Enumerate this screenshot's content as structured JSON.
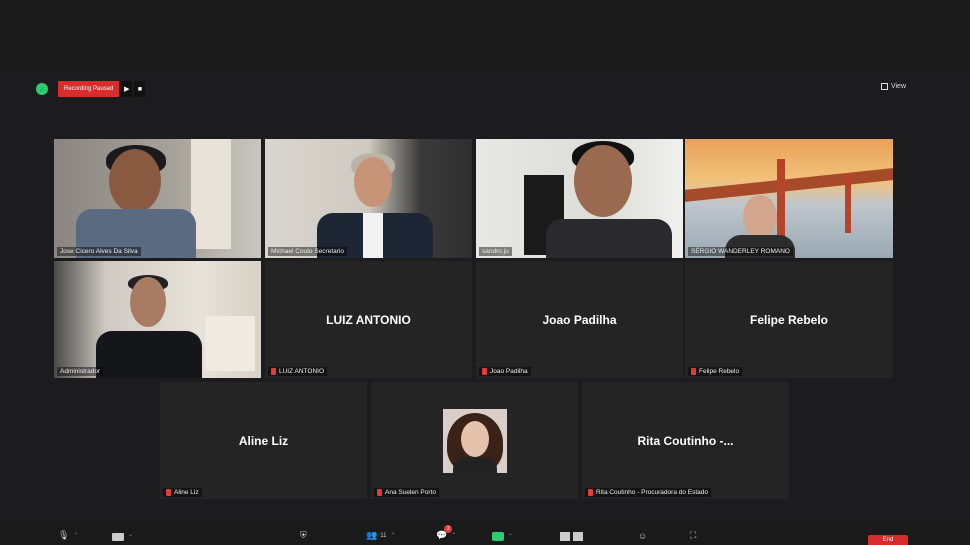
{
  "recording": {
    "status_label": "Recording Paused",
    "play_icon": "▶",
    "stop_icon": "■"
  },
  "view_button": {
    "label": "View"
  },
  "participants": [
    {
      "name": "Jose Cicero Alves Da Silva",
      "display": "",
      "video": true
    },
    {
      "name": "Michael Couto Secretario",
      "display": "",
      "video": true
    },
    {
      "name": "sandro.ju",
      "display": "",
      "video": true
    },
    {
      "name": "SÉRGIO WANDERLEY ROMANO",
      "display": "",
      "video": true,
      "active_speaker": true
    },
    {
      "name": "Administrador",
      "display": "",
      "video": true
    },
    {
      "name": "LUIZ ANTONIO",
      "display": "LUIZ ANTONIO",
      "video": false,
      "muted": true
    },
    {
      "name": "Joao Padilha",
      "display": "Joao Padilha",
      "video": false,
      "muted": true
    },
    {
      "name": "Felipe Rebelo",
      "display": "Felipe Rebelo",
      "video": false,
      "muted": true
    },
    {
      "name": "Aline Liz",
      "display": "Aline Liz",
      "video": false,
      "muted": true
    },
    {
      "name": "Ana Suelen Porto",
      "display": "",
      "video": false,
      "muted": true,
      "profile_picture": true
    },
    {
      "name": "Rita Coutinho - Procuradora do Estado",
      "display": "Rita Coutinho -...",
      "video": false,
      "muted": true
    }
  ],
  "toolbar": {
    "participants_count": "11",
    "chat_badge": "2",
    "end_label": "End"
  },
  "colors": {
    "background": "#1c1c1e",
    "tile": "#242424",
    "recording_red": "#d92c2c",
    "active_speaker_outline": "#d7d23f"
  }
}
